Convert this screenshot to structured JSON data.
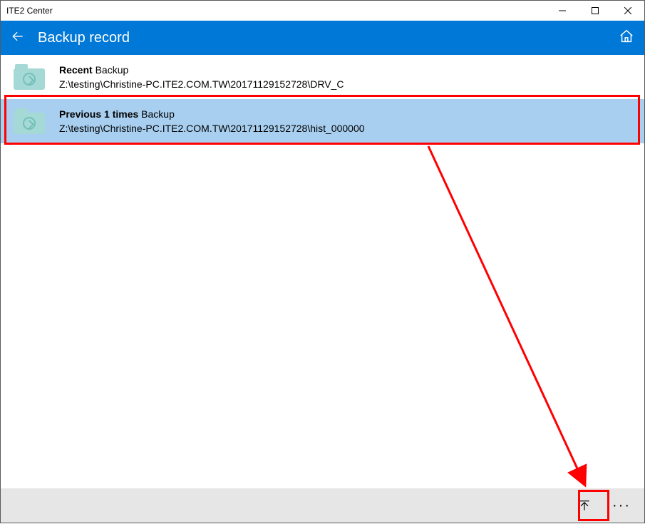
{
  "window": {
    "title": "ITE2 Center"
  },
  "header": {
    "title": "Backup record"
  },
  "items": [
    {
      "label_bold": "Recent",
      "label_rest": "Backup",
      "path": "Z:\\testing\\Christine-PC.ITE2.COM.TW\\20171129152728\\DRV_C"
    },
    {
      "label_bold": "Previous 1 times",
      "label_rest": "Backup",
      "path": "Z:\\testing\\Christine-PC.ITE2.COM.TW\\20171129152728\\hist_000000"
    }
  ],
  "more_glyph": "···"
}
